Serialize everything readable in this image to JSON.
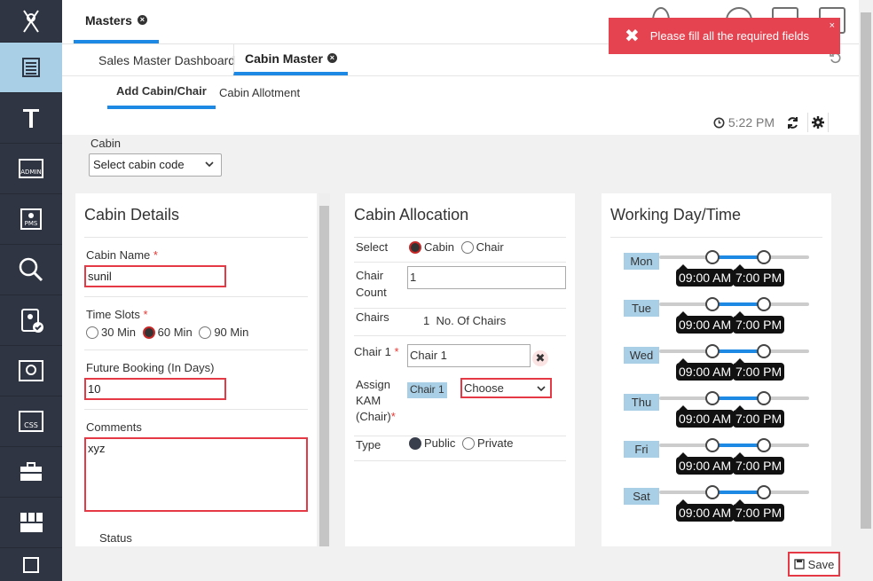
{
  "header": {
    "tab_masters": "Masters"
  },
  "subtabs": {
    "dashboard": "Sales Master Dashboard",
    "cabin_master": "Cabin Master"
  },
  "inner_tabs": {
    "add": "Add Cabin/Chair",
    "allotment": "Cabin Allotment"
  },
  "time": "5:22 PM",
  "cabin": {
    "label": "Cabin",
    "select_value": "Select cabin code"
  },
  "details": {
    "title": "Cabin Details",
    "name_label": "Cabin Name",
    "name_value": "sunil",
    "required_mark": "*",
    "slots_label": "Time Slots",
    "slot_30": "30 Min",
    "slot_60": "60 Min",
    "slot_90": "90 Min",
    "selected_slot": "60 Min",
    "future_label": "Future Booking (In Days)",
    "future_value": "10",
    "comments_label": "Comments",
    "comments_value": "xyz",
    "status_label": "Status"
  },
  "allocation": {
    "title": "Cabin Allocation",
    "select_label": "Select",
    "opt_cabin": "Cabin",
    "opt_chair": "Chair",
    "selected": "Cabin",
    "chair_count_label": "Chair Count",
    "chair_count_value": "1",
    "chairs_label": "Chairs",
    "chairs_count": "1",
    "chairs_text": "No. Of Chairs",
    "chair1_label": "Chair 1",
    "chair1_value": "Chair 1",
    "assign_label": "Assign KAM (Chair)",
    "assign_chip": "Chair 1",
    "assign_select": "Choose",
    "type_label": "Type",
    "type_public": "Public",
    "type_private": "Private",
    "type_selected": "Public"
  },
  "working": {
    "title": "Working Day/Time",
    "days": [
      {
        "day": "Mon",
        "from": "09:00 AM",
        "to": "7:00 PM"
      },
      {
        "day": "Tue",
        "from": "09:00 AM",
        "to": "7:00 PM"
      },
      {
        "day": "Wed",
        "from": "09:00 AM",
        "to": "7:00 PM"
      },
      {
        "day": "Thu",
        "from": "09:00 AM",
        "to": "7:00 PM"
      },
      {
        "day": "Fri",
        "from": "09:00 AM",
        "to": "7:00 PM"
      },
      {
        "day": "Sat",
        "from": "09:00 AM",
        "to": "7:00 PM"
      }
    ]
  },
  "toast": {
    "message": "Please fill all the required fields",
    "close": "×"
  },
  "footer": {
    "save": "Save"
  },
  "colors": {
    "accent": "#1e88e5",
    "error": "#e53945",
    "sidebar": "#2f3542",
    "active_sidebar": "#a9cfe6"
  }
}
